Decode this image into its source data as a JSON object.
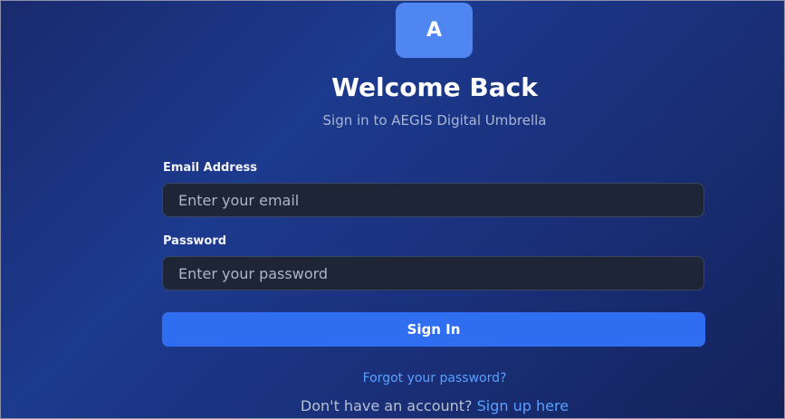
{
  "logo": {
    "letter": "A"
  },
  "header": {
    "title": "Welcome Back",
    "subtitle": "Sign in to AEGIS Digital Umbrella"
  },
  "form": {
    "email": {
      "label": "Email Address",
      "placeholder": "Enter your email",
      "value": ""
    },
    "password": {
      "label": "Password",
      "placeholder": "Enter your password",
      "value": ""
    },
    "submit_label": "Sign In"
  },
  "footer": {
    "forgot_label": "Forgot your password?",
    "signup_prompt": "Don't have an account?",
    "signup_link": "Sign up here"
  },
  "colors": {
    "accent": "#2f6ef0",
    "logo_bg": "#4f86f2",
    "link": "#5aa0ff",
    "input_bg": "#1d2536"
  }
}
